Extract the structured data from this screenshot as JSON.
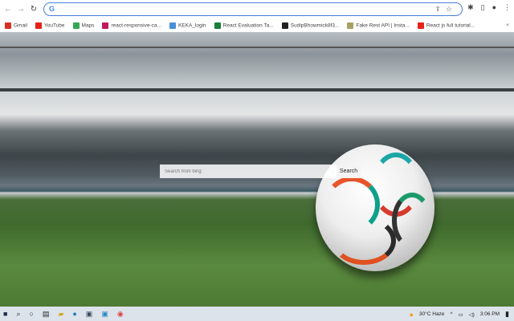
{
  "browser": {
    "omnibox_value": "",
    "google_icon": "G"
  },
  "bookmarks": [
    {
      "label": "Gmail",
      "icon": "gmail-icon",
      "color": "#d93025"
    },
    {
      "label": "YouTube",
      "icon": "youtube-icon",
      "color": "#e62117"
    },
    {
      "label": "Maps",
      "icon": "maps-icon",
      "color": "#34a853"
    },
    {
      "label": "react-responsive-ca...",
      "icon": "page-icon",
      "color": "#c2185b"
    },
    {
      "label": "KEKA_login",
      "icon": "keka-icon",
      "color": "#4a90d9"
    },
    {
      "label": "React Evaluation Ta...",
      "icon": "sheets-icon",
      "color": "#188038"
    },
    {
      "label": "SudipBhowmick8f3...",
      "icon": "github-icon",
      "color": "#222222"
    },
    {
      "label": "Fake Rest API | Insta...",
      "icon": "bulb-icon",
      "color": "#a8a060"
    },
    {
      "label": "React js full tutorial...",
      "icon": "youtube-icon",
      "color": "#e62117"
    }
  ],
  "search": {
    "placeholder": "Search from bing",
    "button": "Search"
  },
  "taskbar": {
    "weather": "30°C  Haze",
    "time": "3:06 PM"
  }
}
